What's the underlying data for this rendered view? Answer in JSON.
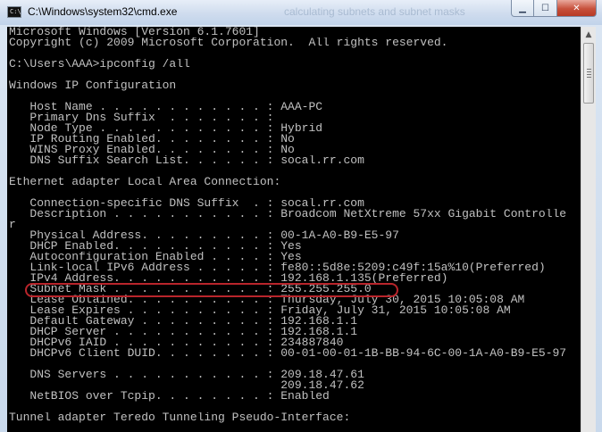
{
  "window": {
    "title": "C:\\Windows\\system32\\cmd.exe",
    "icon_text": "C:\\",
    "background_title_text": "calculating subnets and subnet masks",
    "buttons": {
      "minimize": "minimize",
      "maximize": "maximize",
      "close": "close"
    }
  },
  "console": {
    "lines": [
      "Microsoft Windows [Version 6.1.7601]",
      "Copyright (c) 2009 Microsoft Corporation.  All rights reserved.",
      "",
      "C:\\Users\\AAA>ipconfig /all",
      "",
      "Windows IP Configuration",
      "",
      "   Host Name . . . . . . . . . . . . : AAA-PC",
      "   Primary Dns Suffix  . . . . . . . :",
      "   Node Type . . . . . . . . . . . . : Hybrid",
      "   IP Routing Enabled. . . . . . . . : No",
      "   WINS Proxy Enabled. . . . . . . . : No",
      "   DNS Suffix Search List. . . . . . : socal.rr.com",
      "",
      "Ethernet adapter Local Area Connection:",
      "",
      "   Connection-specific DNS Suffix  . : socal.rr.com",
      "   Description . . . . . . . . . . . : Broadcom NetXtreme 57xx Gigabit Controlle",
      "r",
      "   Physical Address. . . . . . . . . : 00-1A-A0-B9-E5-97",
      "   DHCP Enabled. . . . . . . . . . . : Yes",
      "   Autoconfiguration Enabled . . . . : Yes",
      "   Link-local IPv6 Address . . . . . : fe80::5d8e:5209:c49f:15a%10(Preferred)",
      "   IPv4 Address. . . . . . . . . . . : 192.168.1.135(Preferred)",
      "   Subnet Mask . . . . . . . . . . . : 255.255.255.0",
      "   Lease Obtained. . . . . . . . . . : Thursday, July 30, 2015 10:05:08 AM",
      "   Lease Expires . . . . . . . . . . : Friday, July 31, 2015 10:05:08 AM",
      "   Default Gateway . . . . . . . . . : 192.168.1.1",
      "   DHCP Server . . . . . . . . . . . : 192.168.1.1",
      "   DHCPv6 IAID . . . . . . . . . . . : 234887840",
      "   DHCPv6 Client DUID. . . . . . . . : 00-01-00-01-1B-BB-94-6C-00-1A-A0-B9-E5-97",
      "",
      "   DNS Servers . . . . . . . . . . . : 209.18.47.61",
      "                                       209.18.47.62",
      "   NetBIOS over Tcpip. . . . . . . . : Enabled",
      "",
      "Tunnel adapter Teredo Tunneling Pseudo-Interface:"
    ]
  },
  "scrollbar": {
    "up_arrow": "▲"
  },
  "colors": {
    "console_bg": "#000000",
    "console_text": "#c0c0c0",
    "highlight": "#b9252b"
  }
}
